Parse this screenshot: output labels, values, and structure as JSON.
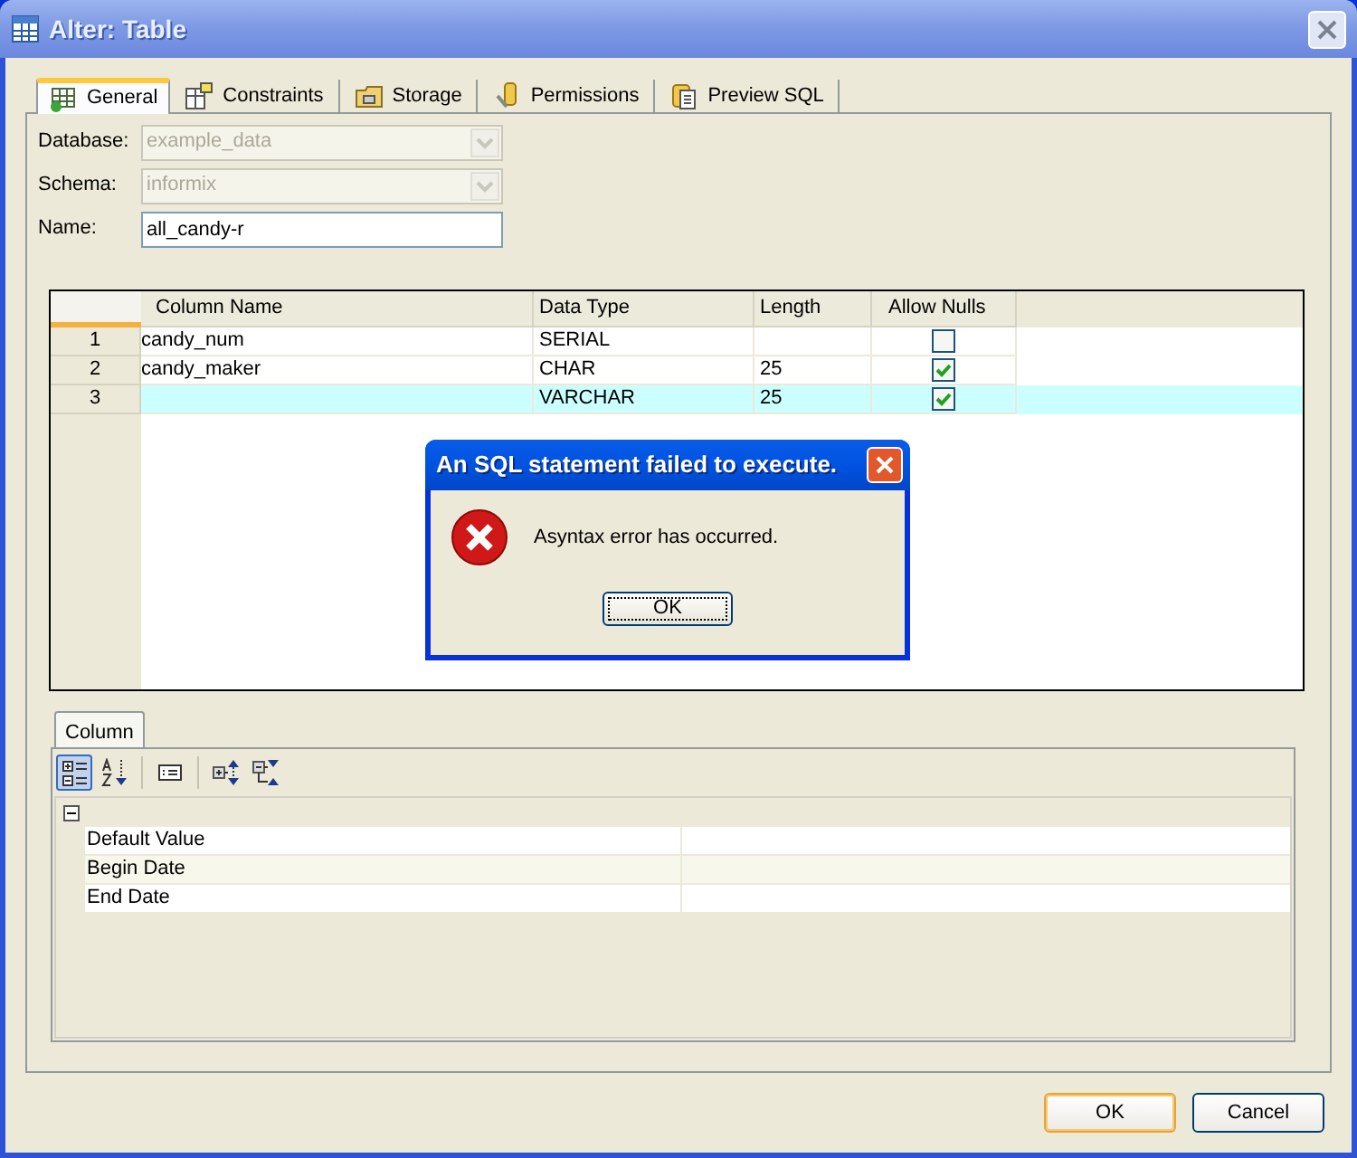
{
  "window": {
    "title": "Alter: Table"
  },
  "tabs": [
    {
      "label": "General",
      "selected": true
    },
    {
      "label": "Constraints",
      "selected": false
    },
    {
      "label": "Storage",
      "selected": false
    },
    {
      "label": "Permissions",
      "selected": false
    },
    {
      "label": "Preview SQL",
      "selected": false
    }
  ],
  "form": {
    "fields": [
      {
        "kind": "combo",
        "label": "Database:",
        "value": "example_data",
        "disabled": true
      },
      {
        "kind": "combo",
        "label": "Schema:",
        "value": "informix",
        "disabled": true
      },
      {
        "kind": "text",
        "label": "Name:",
        "value": "all_candy-r",
        "disabled": false
      }
    ]
  },
  "columns_grid": {
    "columns": [
      "Column Name",
      "Data Type",
      "Length",
      "Allow Nulls"
    ],
    "rows": [
      {
        "number": "1",
        "column_name": "candy_num",
        "data_type": "SERIAL",
        "allow_nulls": false,
        "selected": false
      },
      {
        "number": "2",
        "column_name": "candy_maker",
        "data_type": "CHAR",
        "length": "25",
        "allow_nulls": true,
        "selected": false
      },
      {
        "number": "3",
        "data_type": "VARCHAR",
        "length": "25",
        "allow_nulls": true,
        "selected": true
      }
    ]
  },
  "property_panel": {
    "tab": "Column",
    "toolbar": [
      {
        "kind": "categorized",
        "selected": true
      },
      {
        "kind": "alphabetical",
        "selected": false
      },
      {
        "kind": "pages",
        "selected": false
      },
      {
        "kind": "expand",
        "selected": false
      },
      {
        "kind": "collapse",
        "selected": false
      }
    ],
    "group": {
      "expanded": true
    },
    "properties": [
      {
        "name": "Default Value"
      },
      {
        "name": "Begin Date"
      },
      {
        "name": "End Date"
      }
    ]
  },
  "error_dialog": {
    "title": "An SQL statement failed to execute.",
    "message": "Asyntax error has occurred.",
    "button": "OK"
  },
  "buttons": [
    {
      "label": "OK",
      "default": true
    },
    {
      "label": "Cancel",
      "default": false
    }
  ]
}
